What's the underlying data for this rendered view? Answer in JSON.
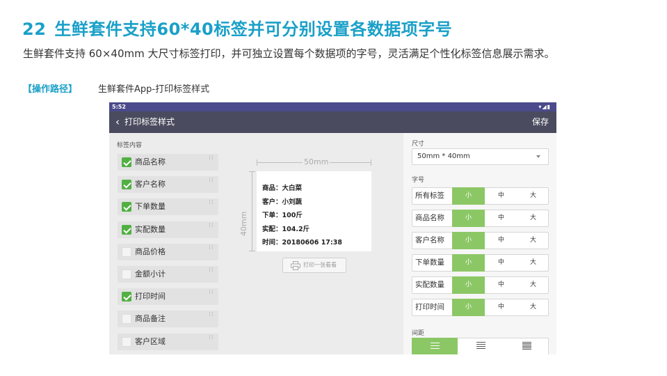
{
  "slide": {
    "number": "22",
    "title": "生鲜套件支持60*40标签并可分别设置各数据项字号",
    "description": "生鲜套件支持 60×40mm 大尺寸标签打印，并可独立设置每个数据项的字号，灵活满足个性化标签信息展示需求。",
    "path_label": "【操作路径】",
    "path_value": "生鲜套件App-打印标签样式"
  },
  "device": {
    "status_time": "5:52",
    "status_icons": "▾◢▮",
    "appbar": {
      "back_icon": "‹",
      "title": "打印标签样式",
      "save": "保存"
    },
    "left": {
      "section_label": "标签内容",
      "fields": [
        {
          "label": "商品名称",
          "checked": true
        },
        {
          "label": "客户名称",
          "checked": true
        },
        {
          "label": "下单数量",
          "checked": true
        },
        {
          "label": "实配数量",
          "checked": true
        },
        {
          "label": "商品价格",
          "checked": false
        },
        {
          "label": "金额小计",
          "checked": false
        },
        {
          "label": "打印时间",
          "checked": true
        },
        {
          "label": "商品备注",
          "checked": false
        },
        {
          "label": "客户区域",
          "checked": false
        }
      ]
    },
    "center": {
      "width_label": "50mm",
      "height_label": "40mm",
      "preview_lines": [
        "商品：大白菜",
        "客户：小刘蔬",
        "下单：100斤",
        "实配：104.2斤",
        "时间：20180606 17:38"
      ],
      "print_button": "打印一张看看"
    },
    "right": {
      "size_label": "尺寸",
      "size_value": "50mm * 40mm",
      "font_label": "字号",
      "font_options": [
        "小",
        "中",
        "大"
      ],
      "font_rows": [
        {
          "label": "所有标签",
          "selected": 0
        },
        {
          "label": "商品名称",
          "selected": 0
        },
        {
          "label": "客户名称",
          "selected": 0
        },
        {
          "label": "下单数量",
          "selected": 0
        },
        {
          "label": "实配数量",
          "selected": 0
        },
        {
          "label": "打印时间",
          "selected": 0
        }
      ],
      "spacing_label": "间距",
      "spacing_selected": 0
    },
    "colors": {
      "accent": "#8cc766",
      "checkbox": "#52b043",
      "title": "#1aa0c8",
      "appbar": "#4b4b5f"
    }
  }
}
